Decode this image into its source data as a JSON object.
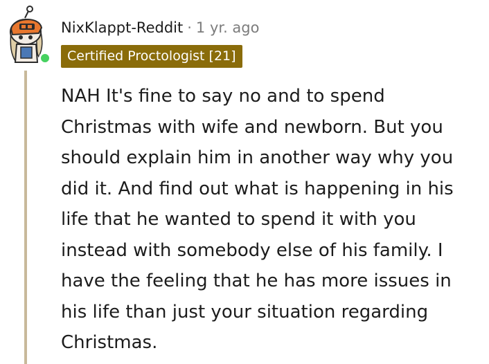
{
  "comment": {
    "username": "NixKlappt-Reddit",
    "separator": "·",
    "timestamp": "1 yr. ago",
    "flair": "Certified Proctologist [21]",
    "body": "NAH It's fine to say no and to spend Christmas with wife and newborn. But you should explain him in another way why you did it. And find out what is happening in his life that he wanted to spend it with you instead with somebody else of his family. I have the feeling that he has more issues in his life than just your situation regarding Christmas."
  },
  "colors": {
    "flair_background": "#8a6c0a",
    "online_status": "#46d160",
    "thread_line": "#c8b99a",
    "meta_text": "#7c7c7c"
  },
  "icons": {
    "avatar": "snoo-avatar-icon",
    "status": "online-status-icon"
  }
}
